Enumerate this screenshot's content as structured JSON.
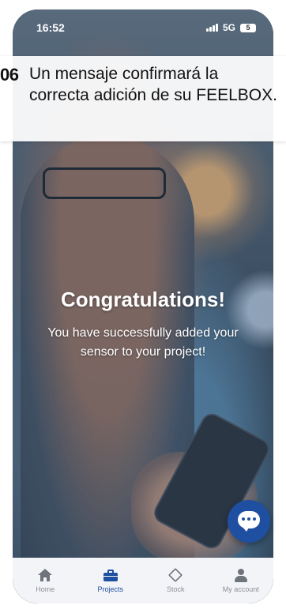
{
  "status_bar": {
    "time": "16:52",
    "network": "5G",
    "battery": "5"
  },
  "instruction": {
    "step": "06",
    "text": "Un mensaje confirmará la correcta adición de su FEELBOX."
  },
  "confirmation": {
    "title": "Congratulations!",
    "message": "You have successfully added your sensor to your project!"
  },
  "tab_bar": {
    "items": [
      {
        "label": "Home",
        "icon": "home-icon",
        "active": false
      },
      {
        "label": "Projects",
        "icon": "briefcase-icon",
        "active": true
      },
      {
        "label": "Stock",
        "icon": "box-icon",
        "active": false
      },
      {
        "label": "My account",
        "icon": "user-icon",
        "active": false
      }
    ]
  },
  "chat": {
    "icon": "chat-bubble-icon"
  },
  "colors": {
    "accent": "#1f4fa0",
    "tab_inactive": "#8a8f98",
    "tab_bar_bg": "#f3f4f7"
  }
}
